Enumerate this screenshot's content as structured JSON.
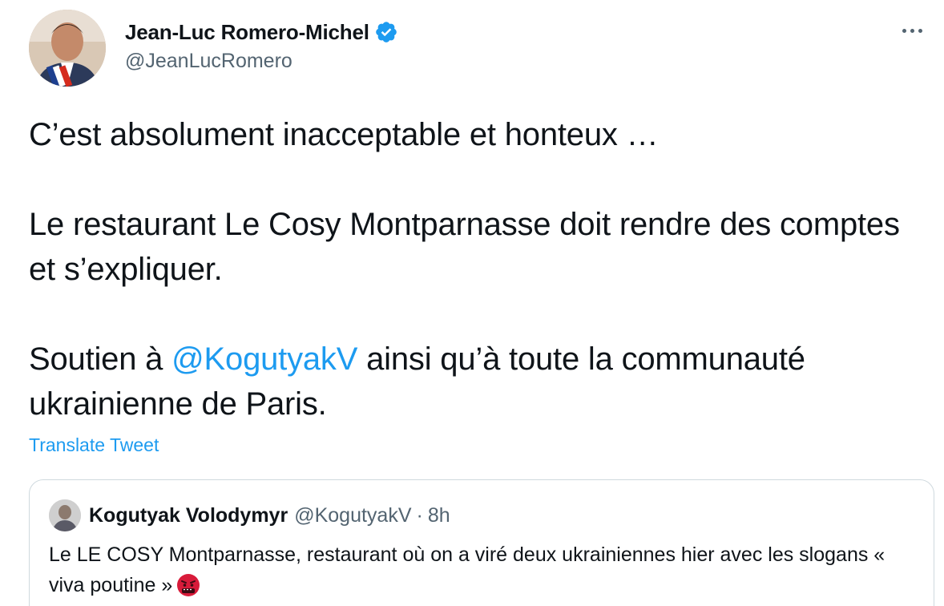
{
  "author": {
    "display_name": "Jean-Luc Romero-Michel",
    "handle": "@JeanLucRomero",
    "verified": true
  },
  "tweet": {
    "line1": "C’est absolument inacceptable et honteux …",
    "line2": "Le restaurant Le Cosy Montparnasse doit rendre des comptes et s’expliquer.",
    "line3_before": "Soutien à ",
    "line3_mention": "@KogutyakV",
    "line3_after": " ainsi qu’à toute la communauté ukrainienne de Paris.",
    "translate_label": "Translate Tweet"
  },
  "quoted": {
    "display_name": "Kogutyak Volodymyr",
    "handle": "@KogutyakV",
    "separator": "·",
    "time": "8h",
    "text": "Le LE COSY Montparnasse, restaurant où on a viré deux ukrainiennes hier avec les slogans « viva poutine »",
    "emoji": "angry-face-emoji"
  },
  "icons": {
    "more": "more-options-icon",
    "verified": "verified-badge-icon"
  },
  "colors": {
    "accent": "#1d9bf0",
    "text": "#0f1419",
    "secondary": "#536471",
    "border": "#cfd9de"
  }
}
